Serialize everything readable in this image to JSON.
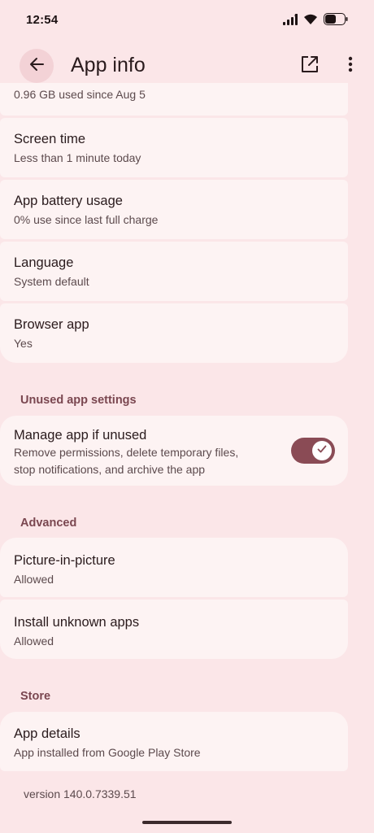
{
  "status_bar": {
    "time": "12:54"
  },
  "app_bar": {
    "title": "App info"
  },
  "items": {
    "storage_sub": "0.96 GB used since Aug 5",
    "screen_time_title": "Screen time",
    "screen_time_sub": "Less than 1 minute today",
    "battery_title": "App battery usage",
    "battery_sub": "0% use since last full charge",
    "language_title": "Language",
    "language_sub": "System default",
    "browser_title": "Browser app",
    "browser_sub": "Yes"
  },
  "unused": {
    "header": "Unused app settings",
    "manage_title": "Manage app if unused",
    "manage_sub_line1": "Remove permissions, delete temporary files,",
    "manage_sub_line2": "stop notifications, and archive the app",
    "toggle_on": true
  },
  "advanced": {
    "header": "Advanced",
    "pip_title": "Picture-in-picture",
    "pip_sub": "Allowed",
    "install_title": "Install unknown apps",
    "install_sub": "Allowed"
  },
  "store": {
    "header": "Store",
    "details_title": "App details",
    "details_sub": "App installed from Google Play Store"
  },
  "footer": {
    "version": "version 140.0.7339.51"
  },
  "colors": {
    "background": "#fbe6e8",
    "card": "#fdf3f3",
    "accent": "#8a4b55",
    "section_header": "#7a4750"
  }
}
